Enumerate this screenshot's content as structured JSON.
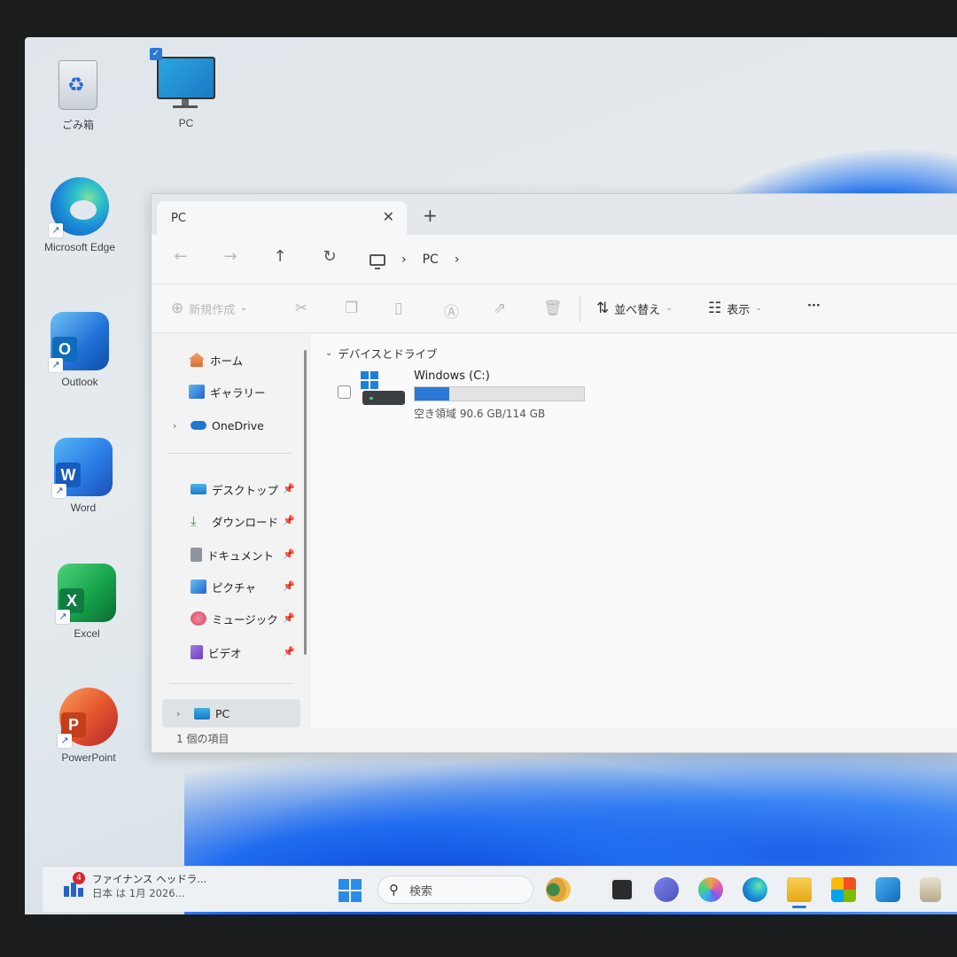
{
  "desktop": {
    "icons": [
      {
        "label": "ごみ箱"
      },
      {
        "label": "PC"
      },
      {
        "label": "Microsoft Edge"
      },
      {
        "label": "Outlook"
      },
      {
        "label": "Word"
      },
      {
        "label": "Excel"
      },
      {
        "label": "PowerPoint"
      }
    ]
  },
  "window": {
    "tab_title": "PC",
    "tab_close": "✕",
    "tab_add": "+",
    "nav": {
      "back": "←",
      "forward": "→",
      "up": "↑",
      "refresh": "↻"
    },
    "breadcrumb": {
      "sep1": "›",
      "location": "PC",
      "sep2": "›"
    },
    "toolbar": {
      "new_label": "新規作成",
      "sort_label": "並べ替え",
      "view_label": "表示",
      "more_label": "···"
    },
    "sidebar": {
      "home": "ホーム",
      "gallery": "ギャラリー",
      "onedrive": "OneDrive",
      "desktop": "デスクトップ",
      "downloads": "ダウンロード",
      "documents": "ドキュメント",
      "pictures": "ピクチャ",
      "music": "ミュージック",
      "videos": "ビデオ",
      "pc": "PC"
    },
    "content": {
      "group_header": "デバイスとドライブ",
      "drive_name": "Windows (C:)",
      "drive_space": "空き領域 90.6 GB/114 GB",
      "drive_used_fraction": 0.205
    },
    "status": "1 個の項目"
  },
  "taskbar": {
    "news_badge": "4",
    "news_title": "ファイナンス ヘッドラ...",
    "news_sub": "日本 は 1月 2026...",
    "search_placeholder": "検索",
    "search_icon": "⚲"
  },
  "colors": {
    "accent": "#2b78d8",
    "edge": "#1d8ad8",
    "word": "#185abd",
    "excel": "#107c41",
    "powerpoint": "#c43e1c",
    "outlook": "#0f6cbd"
  }
}
